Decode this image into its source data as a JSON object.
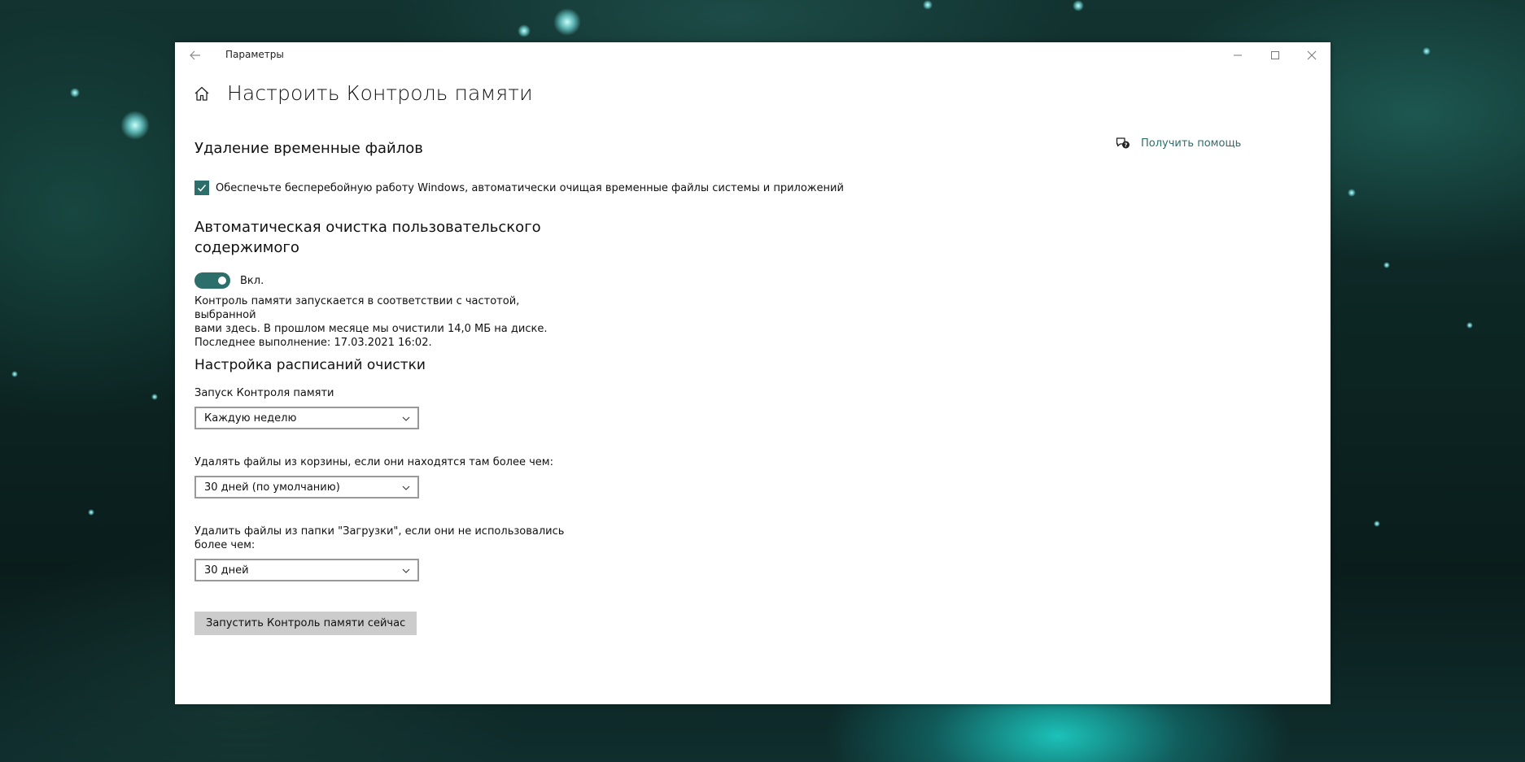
{
  "window": {
    "app_title": "Параметры"
  },
  "page": {
    "title": "Настроить Контроль памяти"
  },
  "help": {
    "label": "Получить помощь"
  },
  "temp_files": {
    "heading": "Удаление временные файлов",
    "checkbox_label": "Обеспечьте бесперебойную работу Windows, автоматически очищая временные файлы системы и приложений",
    "checked": true
  },
  "auto_clean": {
    "heading_line1": "Автоматическая очистка пользовательского",
    "heading_line2": "содержимого",
    "toggle_label": "Вкл.",
    "toggle_on": true,
    "desc_line1": "Контроль памяти запускается в соответствии с частотой, выбранной",
    "desc_line2": "вами здесь. В прошлом месяце мы очистили 14,0 МБ на диске.",
    "desc_line3": "Последнее выполнение: 17.03.2021 16:02."
  },
  "schedule": {
    "heading": "Настройка расписаний очистки",
    "run_label": "Запуск Контроля памяти",
    "run_value": "Каждую неделю",
    "recycle_label": "Удалять файлы из корзины, если они находятся там более чем:",
    "recycle_value": "30 дней (по умолчанию)",
    "downloads_label_line1": "Удалить файлы из папки \"Загрузки\", если они не использовались",
    "downloads_label_line2": "более чем:",
    "downloads_value": "30 дней"
  },
  "actions": {
    "run_now": "Запустить Контроль памяти сейчас"
  },
  "colors": {
    "accent": "#2c6e69",
    "link": "#2a6f6b",
    "button_bg": "#cccccc"
  }
}
